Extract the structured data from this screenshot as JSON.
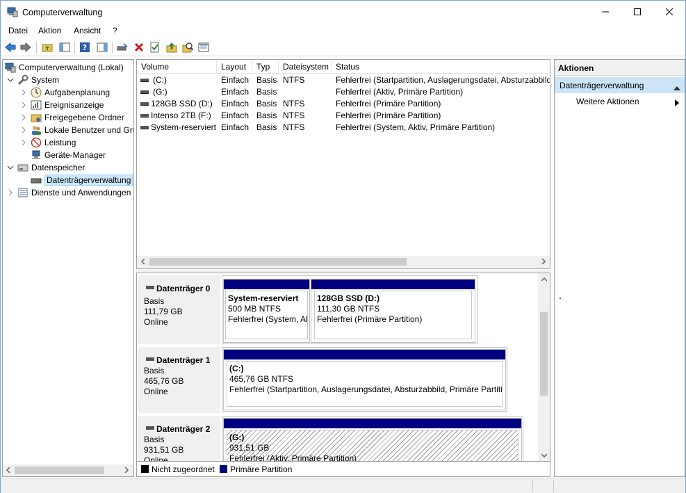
{
  "window": {
    "title": "Computerverwaltung"
  },
  "menu": {
    "items": [
      "Datei",
      "Aktion",
      "Ansicht",
      "?"
    ]
  },
  "tree": {
    "root": "Computerverwaltung (Lokal)",
    "system": "System",
    "items": [
      "Aufgabenplanung",
      "Ereignisanzeige",
      "Freigegebene Ordner",
      "Lokale Benutzer und Gruppen",
      "Leistung",
      "Geräte-Manager"
    ],
    "storage": "Datenspeicher",
    "disk_mgmt": "Datenträgerverwaltung",
    "services": "Dienste und Anwendungen"
  },
  "volumes": {
    "columns": [
      "Volume",
      "Layout",
      "Typ",
      "Dateisystem",
      "Status"
    ],
    "rows": [
      {
        "volume": "(C:)",
        "layout": "Einfach",
        "type": "Basis",
        "fs": "NTFS",
        "status": "Fehlerfrei (Startpartition, Auslagerungsdatei, Absturzabbild, Primäre Partition)"
      },
      {
        "volume": "(G:)",
        "layout": "Einfach",
        "type": "Basis",
        "fs": "",
        "status": "Fehlerfrei (Aktiv, Primäre Partition)"
      },
      {
        "volume": "128GB SSD (D:)",
        "layout": "Einfach",
        "type": "Basis",
        "fs": "NTFS",
        "status": "Fehlerfrei (Primäre Partition)"
      },
      {
        "volume": "Intenso 2TB  (F:)",
        "layout": "Einfach",
        "type": "Basis",
        "fs": "NTFS",
        "status": "Fehlerfrei (Primäre Partition)"
      },
      {
        "volume": "System-reserviert",
        "layout": "Einfach",
        "type": "Basis",
        "fs": "NTFS",
        "status": "Fehlerfrei (System, Aktiv, Primäre Partition)"
      }
    ]
  },
  "disks": [
    {
      "name": "Datenträger 0",
      "type": "Basis",
      "size": "111,79 GB",
      "state": "Online",
      "partitions": [
        {
          "name": "System-reserviert",
          "size": "500 MB NTFS",
          "status": "Fehlerfrei (System, Aktiv, Primäre Partition)"
        },
        {
          "name": "128GB SSD  (D:)",
          "size": "111,30 GB NTFS",
          "status": "Fehlerfrei (Primäre Partition)"
        }
      ]
    },
    {
      "name": "Datenträger 1",
      "type": "Basis",
      "size": "465,76 GB",
      "state": "Online",
      "partitions": [
        {
          "name": "(C:)",
          "size": "465,76 GB NTFS",
          "status": "Fehlerfrei (Startpartition, Auslagerungsdatei, Absturzabbild, Primäre Partition)"
        }
      ]
    },
    {
      "name": "Datenträger 2",
      "type": "Basis",
      "size": "931,51 GB",
      "state": "Online",
      "partitions": [
        {
          "name": "(G:)",
          "size": "931,51 GB",
          "status": "Fehlerfrei (Aktiv, Primäre Partition)"
        }
      ]
    }
  ],
  "legend": {
    "unallocated": "Nicht zugeordnet",
    "primary": "Primäre Partition",
    "unallocated_color": "#000000",
    "primary_color": "#000080"
  },
  "actions": {
    "header": "Aktionen",
    "section": "Datenträgerverwaltung",
    "more": "Weitere Aktionen"
  }
}
